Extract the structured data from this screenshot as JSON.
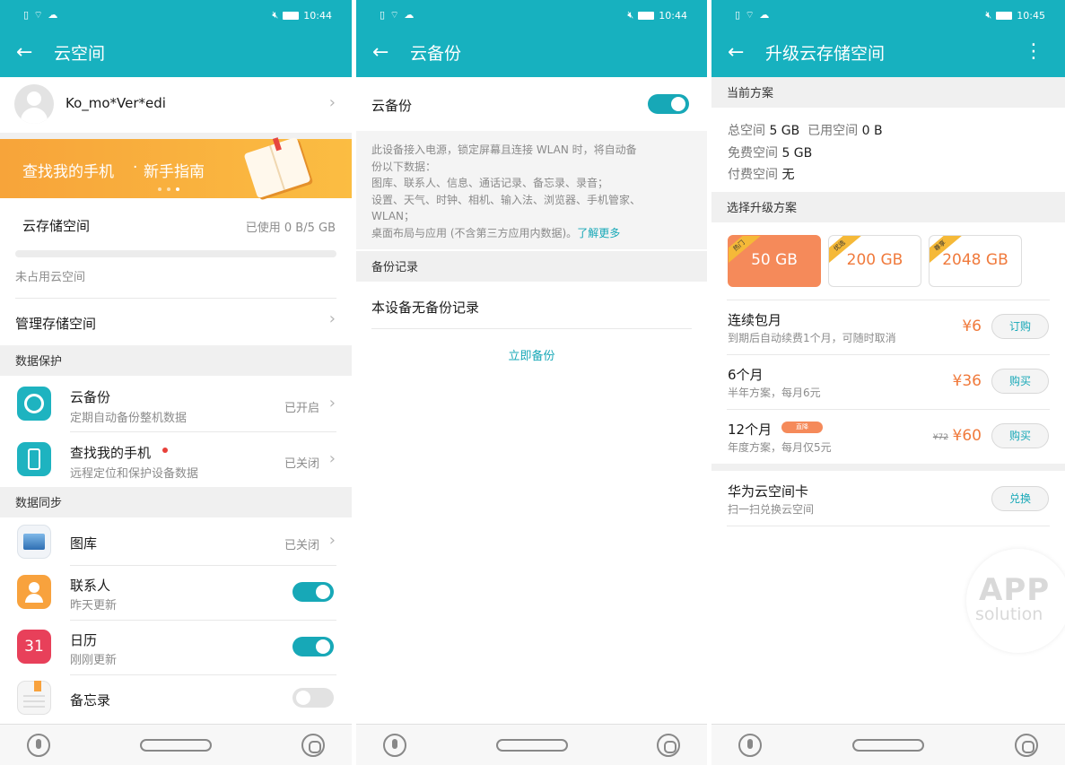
{
  "status": {
    "p1_time": "10:44",
    "p2_time": "10:44",
    "p3_time": "10:45"
  },
  "panel1": {
    "title": "云空间",
    "user_name": "Ko_mo*Ver*edi",
    "banner_text_main": "查找我的手机",
    "banner_text_sep": "·",
    "banner_text_sub": "新手指南",
    "storage_label": "云存储空间",
    "storage_used": "已使用 0 B/5 GB",
    "storage_used_fraction": 0.0,
    "unused_label": "未占用云空间",
    "manage_label": "管理存储空间",
    "section_protect": "数据保护",
    "backup": {
      "title": "云备份",
      "subtitle": "定期自动备份整机数据",
      "status": "已开启"
    },
    "findphone": {
      "title": "查找我的手机",
      "subtitle": "远程定位和保护设备数据",
      "status": "已关闭"
    },
    "section_sync": "数据同步",
    "gallery": {
      "title": "图库",
      "status": "已关闭"
    },
    "contacts": {
      "title": "联系人",
      "subtitle": "昨天更新",
      "on": true
    },
    "calendar": {
      "title": "日历",
      "subtitle": "刚刚更新",
      "icon_text": "31",
      "on": true
    },
    "notes": {
      "title": "备忘录",
      "on": false
    }
  },
  "panel2": {
    "title": "云备份",
    "backup_label": "云备份",
    "backup_on": true,
    "desc_lines": [
      "此设备接入电源，锁定屏幕且连接 WLAN 时，将自动备",
      "份以下数据：",
      "图库、联系人、信息、通话记录、备忘录、录音；",
      "设置、天气、时钟、相机、输入法、浏览器、手机管家、",
      "WLAN；"
    ],
    "desc_last": "桌面布局与应用 (不含第三方应用内数据)。",
    "learn_more": "了解更多",
    "section_records": "备份记录",
    "no_records": "本设备无备份记录",
    "backup_now": "立即备份"
  },
  "panel3": {
    "title": "升级云存储空间",
    "section_current": "当前方案",
    "total_label": "总空间",
    "total_value": "5 GB",
    "used_label": "已用空间",
    "used_value": "0 B",
    "free_label": "免费空间",
    "free_value": "5 GB",
    "paid_label": "付费空间",
    "paid_value": "无",
    "section_choose": "选择升级方案",
    "plans": [
      {
        "size": "50 GB",
        "badge": "热门",
        "selected": true
      },
      {
        "size": "200 GB",
        "badge": "优选",
        "selected": false
      },
      {
        "size": "2048 GB",
        "badge": "尊享",
        "selected": false
      }
    ],
    "offers": [
      {
        "title": "连续包月",
        "subtitle": "到期后自动续费1个月，可随时取消",
        "price": "¥6",
        "button": "订购"
      },
      {
        "title": "6个月",
        "subtitle": "半年方案，每月6元",
        "price": "¥36",
        "button": "购买"
      },
      {
        "title": "12个月",
        "tag": "直降",
        "subtitle": "年度方案，每月仅5元",
        "old_price": "¥72",
        "price": "¥60",
        "button": "购买"
      }
    ],
    "card": {
      "title": "华为云空间卡",
      "subtitle": "扫一扫兑换云空间",
      "button": "兑换"
    },
    "watermark_top": "APP",
    "watermark_bottom": "solution"
  },
  "colors": {
    "accent": "#17b1bf",
    "orange": "#f07a3c",
    "banner": "#f9a52b"
  }
}
